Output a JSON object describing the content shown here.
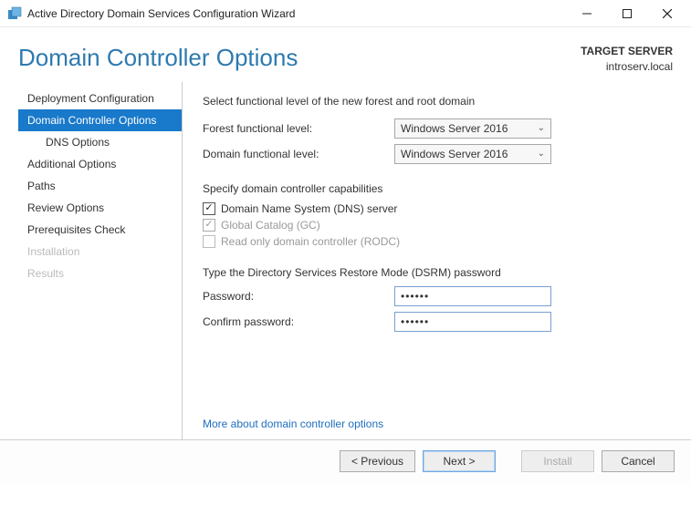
{
  "window": {
    "title": "Active Directory Domain Services Configuration Wizard"
  },
  "header": {
    "pageTitle": "Domain Controller Options",
    "targetLabel": "TARGET SERVER",
    "targetValue": "introserv.local"
  },
  "sidebar": {
    "items": [
      {
        "label": "Deployment Configuration",
        "state": "normal"
      },
      {
        "label": "Domain Controller Options",
        "state": "active"
      },
      {
        "label": "DNS Options",
        "state": "sub"
      },
      {
        "label": "Additional Options",
        "state": "normal"
      },
      {
        "label": "Paths",
        "state": "normal"
      },
      {
        "label": "Review Options",
        "state": "normal"
      },
      {
        "label": "Prerequisites Check",
        "state": "normal"
      },
      {
        "label": "Installation",
        "state": "disabled"
      },
      {
        "label": "Results",
        "state": "disabled"
      }
    ]
  },
  "content": {
    "functionalTitle": "Select functional level of the new forest and root domain",
    "forestLabel": "Forest functional level:",
    "forestValue": "Windows Server 2016",
    "domainLabel": "Domain functional level:",
    "domainValue": "Windows Server 2016",
    "capabilitiesTitle": "Specify domain controller capabilities",
    "dnsCheck": "Domain Name System (DNS) server",
    "gcCheck": "Global Catalog (GC)",
    "rodcCheck": "Read only domain controller (RODC)",
    "dsrmTitle": "Type the Directory Services Restore Mode (DSRM) password",
    "passwordLabel": "Password:",
    "passwordValue": "••••••",
    "confirmLabel": "Confirm password:",
    "confirmValue": "••••••",
    "moreLink": "More about domain controller options"
  },
  "footer": {
    "previous": "< Previous",
    "next": "Next >",
    "install": "Install",
    "cancel": "Cancel"
  }
}
